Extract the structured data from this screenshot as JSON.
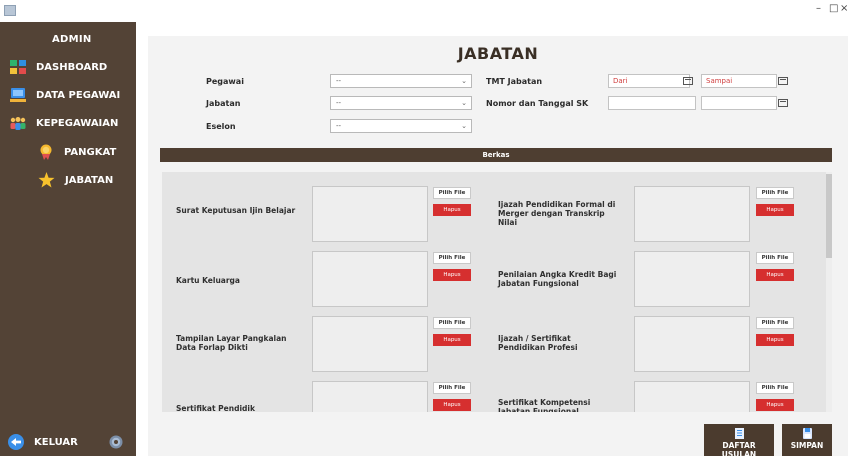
{
  "titlebar": {
    "minimize": "–",
    "maximize": "□",
    "close": "×"
  },
  "sidebar": {
    "title": "ADMIN",
    "items": [
      {
        "label": "DASHBOARD",
        "icon": "dashboard-icon"
      },
      {
        "label": "DATA PEGAWAI",
        "icon": "data-pegawai-icon"
      },
      {
        "label": "KEPEGAWAIAN",
        "icon": "kepegawaian-icon"
      },
      {
        "label": "PANGKAT",
        "icon": "pangkat-icon"
      },
      {
        "label": "JABATAN",
        "icon": "jabatan-star-icon"
      }
    ],
    "logout": "KELUAR"
  },
  "main": {
    "title": "JABATAN",
    "form": {
      "pegawai_label": "Pegawai",
      "pegawai_value": "--",
      "jabatan_label": "Jabatan",
      "jabatan_value": "--",
      "eselon_label": "Eselon",
      "eselon_value": "--",
      "tmt_label": "TMT Jabatan",
      "dari": "Dari",
      "sampai": "Sampai",
      "sk_label": "Nomor dan Tanggal SK"
    },
    "berkas": "Berkas",
    "docs_left": [
      "Surat Keputusan Ijin Belajar",
      "Kartu Keluarga",
      "Tampilan Layar Pangkalan Data Forlap Dikti",
      "Sertifikat Pendidik"
    ],
    "docs_right": [
      "Ijazah Pendidikan Formal di Merger dengan Transkrip Nilai",
      "Penilaian Angka Kredit Bagi Jabatan Fungsional",
      "Ijazah / Sertifikat Pendidikan Profesi",
      "Sertifikat Kompetensi Jabatan Fungsional"
    ],
    "pilih_label": "Pilih File",
    "hapus_label": "Hapus"
  },
  "buttons": {
    "daftar_usulan": "DAFTAR USULAN",
    "simpan": "SIMPAN"
  },
  "colors": {
    "sidebar": "#534336",
    "accent_red": "#d62f2f",
    "header_bar": "#4e3e31"
  }
}
